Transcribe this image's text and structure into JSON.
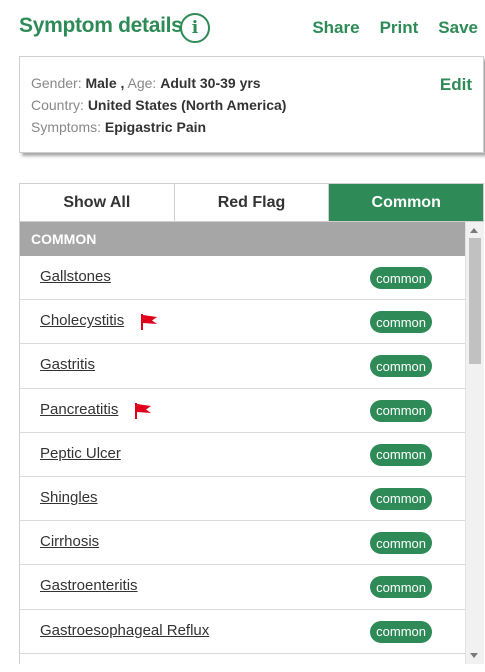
{
  "header": {
    "title": "Symptom details",
    "info_icon": "info-icon",
    "actions": [
      {
        "id": "share",
        "label": "Share"
      },
      {
        "id": "print",
        "label": "Print"
      },
      {
        "id": "save",
        "label": "Save"
      }
    ]
  },
  "summary": {
    "gender_label": "Gender:",
    "gender_value": "Male ,",
    "age_label": "Age:",
    "age_value": "Adult 30-39 yrs",
    "country_label": "Country:",
    "country_value": "United States (North America)",
    "symptoms_label": "Symptoms:",
    "symptoms_value": "Epigastric Pain",
    "edit_label": "Edit"
  },
  "tabs": [
    {
      "label": "Show All",
      "active": false
    },
    {
      "label": "Red Flag",
      "active": false
    },
    {
      "label": "Common",
      "active": true
    }
  ],
  "section": {
    "title": "COMMON"
  },
  "conditions": [
    {
      "name": "Gallstones",
      "red_flag": false,
      "badge": "common"
    },
    {
      "name": "Cholecystitis",
      "red_flag": true,
      "badge": "common"
    },
    {
      "name": "Gastritis",
      "red_flag": false,
      "badge": "common"
    },
    {
      "name": "Pancreatitis",
      "red_flag": true,
      "badge": "common"
    },
    {
      "name": "Peptic Ulcer",
      "red_flag": false,
      "badge": "common"
    },
    {
      "name": "Shingles",
      "red_flag": false,
      "badge": "common"
    },
    {
      "name": "Cirrhosis",
      "red_flag": false,
      "badge": "common"
    },
    {
      "name": "Gastroenteritis",
      "red_flag": false,
      "badge": "common"
    },
    {
      "name": "Gastroesophageal Reflux",
      "red_flag": false,
      "badge": "common"
    }
  ],
  "colors": {
    "accent": "#2e8b57",
    "flag": "#e0001b",
    "section_bg": "#a6a6a6"
  }
}
